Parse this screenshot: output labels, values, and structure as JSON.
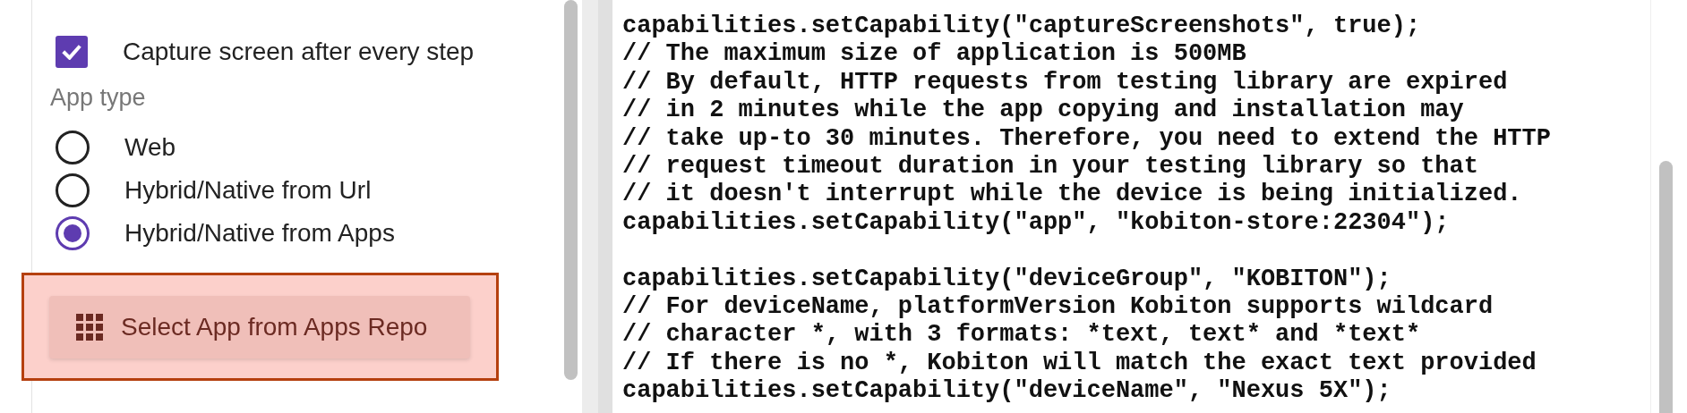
{
  "options": [
    {
      "kind": "checkbox",
      "label": "Capture screen after every step",
      "checked": true
    }
  ],
  "app_type": {
    "label": "App type",
    "choices": [
      {
        "label": "Web",
        "selected": false
      },
      {
        "label": "Hybrid/Native from Url",
        "selected": false
      },
      {
        "label": "Hybrid/Native from Apps",
        "selected": true
      }
    ]
  },
  "select_app_button": {
    "label": "Select App from Apps Repo"
  },
  "code_blocks": [
    [
      "capabilities.setCapability(\"captureScreenshots\", true);",
      "// The maximum size of application is 500MB",
      "// By default, HTTP requests from testing library are expired",
      "// in 2 minutes while the app copying and installation may",
      "// take up-to 30 minutes. Therefore, you need to extend the HTTP",
      "// request timeout duration in your testing library so that",
      "// it doesn't interrupt while the device is being initialized.",
      "capabilities.setCapability(\"app\", \"kobiton-store:22304\");"
    ],
    [
      "capabilities.setCapability(\"deviceGroup\", \"KOBITON\");",
      "// For deviceName, platformVersion Kobiton supports wildcard",
      "// character *, with 3 formats: *text, text* and *text*",
      "// If there is no *, Kobiton will match the exact text provided",
      "capabilities.setCapability(\"deviceName\", \"Nexus 5X\");"
    ]
  ]
}
